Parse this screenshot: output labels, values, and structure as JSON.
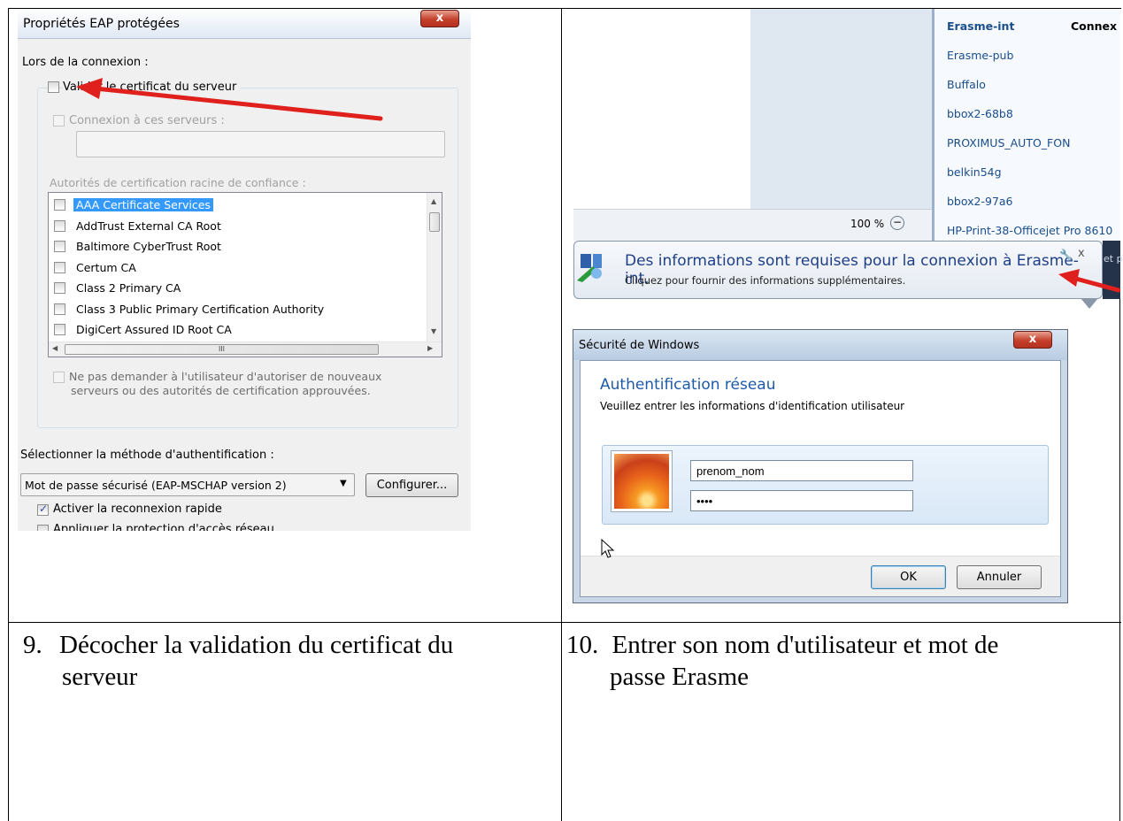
{
  "eap_dialog": {
    "title": "Propriétés EAP protégées",
    "close_label": "x",
    "on_connect_label": "Lors de la connexion :",
    "validate_cert_label": "Valider le certificat du serveur",
    "connect_servers_label": "Connexion à ces serveurs :",
    "servers_input_value": "",
    "trusted_roots_label": "Autorités de certification racine de confiance :",
    "ca_list": [
      {
        "label": "AAA Certificate Services",
        "selected": true
      },
      {
        "label": "AddTrust External CA Root",
        "selected": false
      },
      {
        "label": "Baltimore CyberTrust Root",
        "selected": false
      },
      {
        "label": "Certum CA",
        "selected": false
      },
      {
        "label": "Class 2 Primary CA",
        "selected": false
      },
      {
        "label": "Class 3 Public Primary Certification Authority",
        "selected": false
      },
      {
        "label": "DigiCert Assured ID Root CA",
        "selected": false
      }
    ],
    "hscroll_grip": "III",
    "no_prompt_label_line1": "Ne pas demander à l'utilisateur d'autoriser de nouveaux",
    "no_prompt_label_line2": "serveurs ou des autorités de certification approuvées.",
    "auth_method_label": "Sélectionner la méthode d'authentification :",
    "auth_method_value": "Mot de passe sécurisé (EAP-MSCHAP version 2)",
    "configure_button": "Configurer...",
    "fast_reconnect_label": "Activer la reconnexion rapide",
    "fast_reconnect_checked": true,
    "nap_label": "Appliquer la protection d'accès réseau"
  },
  "wifi_panel": {
    "zoom_label": "100 %",
    "zoom_icon": "zoom-out-icon",
    "connect_label": "Connex",
    "networks": [
      "Erasme-int",
      "Erasme-pub",
      "Buffalo",
      "bbox2-68b8",
      "PROXIMUS_AUTO_FON",
      "belkin54g",
      "bbox2-97a6",
      "HP-Print-38-Officejet Pro 8610"
    ],
    "clipped_text": "et p"
  },
  "notification": {
    "title": "Des informations sont requises pour la connexion à Erasme-int.",
    "subtitle": "Cliquez pour fournir des informations supplémentaires.",
    "close_label": "x"
  },
  "security_dialog": {
    "title": "Sécurité de Windows",
    "close_label": "x",
    "heading": "Authentification réseau",
    "subheading": "Veuillez entrer les informations d'identification utilisateur",
    "username_value": "prenom_nom",
    "password_value": "••••",
    "ok_button": "OK",
    "cancel_button": "Annuler"
  },
  "steps": [
    {
      "number": "9.",
      "text_line1": "Décocher la validation du certificat du",
      "text_line2": "serveur"
    },
    {
      "number": "10.",
      "text_line1": "Entrer son nom d'utilisateur et mot de",
      "text_line2": "passe Erasme"
    }
  ],
  "colors": {
    "link_blue": "#1a4e8c",
    "heading_blue": "#1e5aa8",
    "arrow_red": "#e0201c",
    "selection_blue": "#3399ff"
  }
}
